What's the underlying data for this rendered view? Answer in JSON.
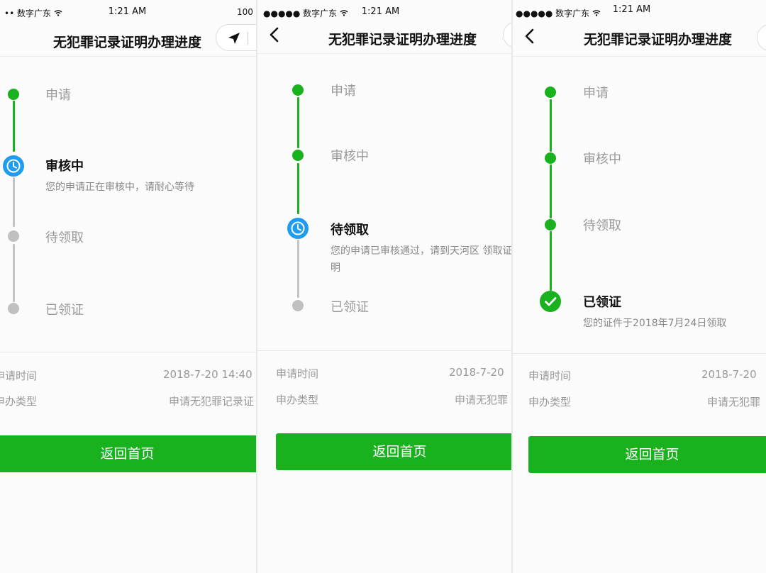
{
  "screens": [
    {
      "status": {
        "carrier": "•• 数字广东",
        "time": "1:21 AM",
        "battery": "100"
      },
      "title": "无犯罪记录证明办理进度",
      "steps": [
        {
          "label": "申请"
        },
        {
          "label": "审核中",
          "desc": "您的申请正在审核中，请耐心等待"
        },
        {
          "label": "待领取"
        },
        {
          "label": "已领证"
        }
      ],
      "info": [
        {
          "key": "申请时间",
          "value": "2018-7-20 14:40"
        },
        {
          "key": "申办类型",
          "value": "申请无犯罪记录证"
        }
      ],
      "button": "返回首页"
    },
    {
      "status": {
        "carrier": "●●●●● 数字广东",
        "time": "1:21 AM"
      },
      "title": "无犯罪记录证明办理进度",
      "steps": [
        {
          "label": "申请"
        },
        {
          "label": "审核中"
        },
        {
          "label": "待领取",
          "desc": "您的申请已审核通过，请到天河区 领取证明"
        },
        {
          "label": "已领证"
        }
      ],
      "info": [
        {
          "key": "申请时间",
          "value": "2018-7-20"
        },
        {
          "key": "申办类型",
          "value": "申请无犯罪"
        }
      ],
      "button": "返回首页"
    },
    {
      "status": {
        "carrier": "●●●●● 数字广东",
        "time": "1:21 AM"
      },
      "title": "无犯罪记录证明办理进度",
      "steps": [
        {
          "label": "申请"
        },
        {
          "label": "审核中"
        },
        {
          "label": "待领取"
        },
        {
          "label": "已领证",
          "desc": "您的证件于2018年7月24日领取"
        }
      ],
      "info": [
        {
          "key": "申请时间",
          "value": "2018-7-20"
        },
        {
          "key": "申办类型",
          "value": "申请无犯罪"
        }
      ],
      "button": "返回首页"
    }
  ],
  "colors": {
    "green": "#1ab11f",
    "blue": "#1e9cf0",
    "gray": "#c0c0c0"
  },
  "icons": {
    "clock": "clock-icon",
    "check": "check-icon",
    "back": "back-arrow-icon",
    "share": "navigation-arrow-icon",
    "wifi": "wifi-icon"
  }
}
